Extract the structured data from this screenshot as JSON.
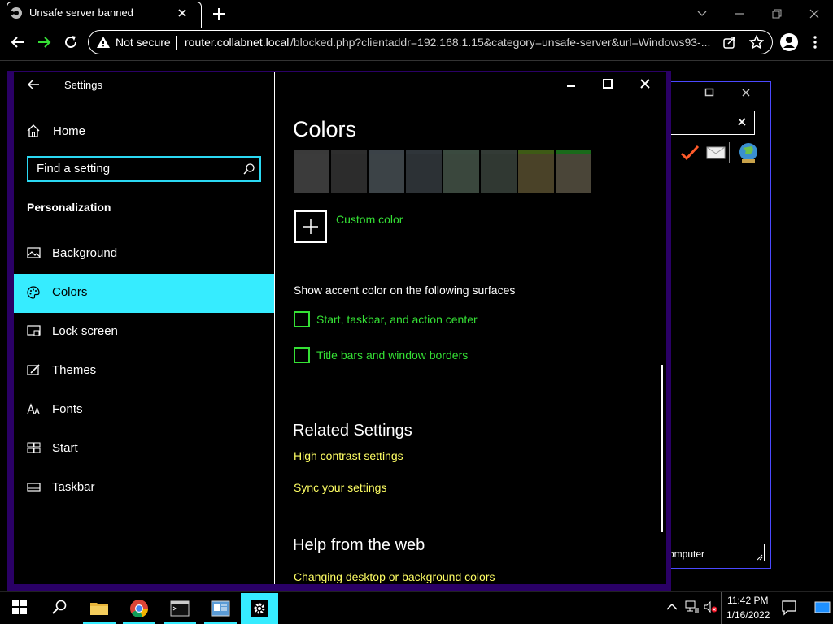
{
  "browser": {
    "tab_title": "Unsafe server banned",
    "security_label": "Not secure",
    "url_host": "router.collabnet.local",
    "url_path": "/blocked.php?clientaddr=192.168.1.15&category=unsafe-server&url=Windows93-..."
  },
  "settings": {
    "app_title": "Settings",
    "home_label": "Home",
    "search_placeholder": "Find a setting",
    "section_label": "Personalization",
    "nav": [
      {
        "label": "Background",
        "icon": "picture-icon"
      },
      {
        "label": "Colors",
        "icon": "palette-icon",
        "selected": true
      },
      {
        "label": "Lock screen",
        "icon": "lock-screen-icon"
      },
      {
        "label": "Themes",
        "icon": "themes-icon"
      },
      {
        "label": "Fonts",
        "icon": "fonts-icon"
      },
      {
        "label": "Start",
        "icon": "start-icon"
      },
      {
        "label": "Taskbar",
        "icon": "taskbar-icon"
      }
    ],
    "content": {
      "heading": "Colors",
      "swatches": [
        {
          "strip": "#3a3a3a",
          "fill": "#3b3b3b"
        },
        {
          "strip": "#2e2e2e",
          "fill": "#2c2c2c"
        },
        {
          "strip": "#3b4248",
          "fill": "#3c4347"
        },
        {
          "strip": "#2f353a",
          "fill": "#2c3135"
        },
        {
          "strip": "#3a4a3f",
          "fill": "#3a473d"
        },
        {
          "strip": "#333b36",
          "fill": "#303832"
        },
        {
          "strip": "#3e5a15",
          "fill": "#4a4228"
        },
        {
          "strip": "#1a6a1a",
          "fill": "#4a4538"
        }
      ],
      "custom_color_label": "Custom color",
      "accent_heading": "Show accent color on the following surfaces",
      "checkboxes": [
        {
          "label": "Start, taskbar, and action center",
          "checked": false
        },
        {
          "label": "Title bars and window borders",
          "checked": false
        }
      ],
      "related_heading": "Related Settings",
      "related_links": [
        "High contrast settings",
        "Sync your settings"
      ],
      "help_heading": "Help from the web",
      "help_links": [
        "Changing desktop or background colors"
      ]
    }
  },
  "background_window": {
    "status_text": "omputer"
  },
  "taskbar": {
    "time": "11:42 PM",
    "date": "1/16/2022"
  },
  "colors": {
    "accent_cyan": "#36ecff",
    "link_green": "#35e035",
    "link_yellow": "#ffff64",
    "window_border": "#2a0066"
  }
}
